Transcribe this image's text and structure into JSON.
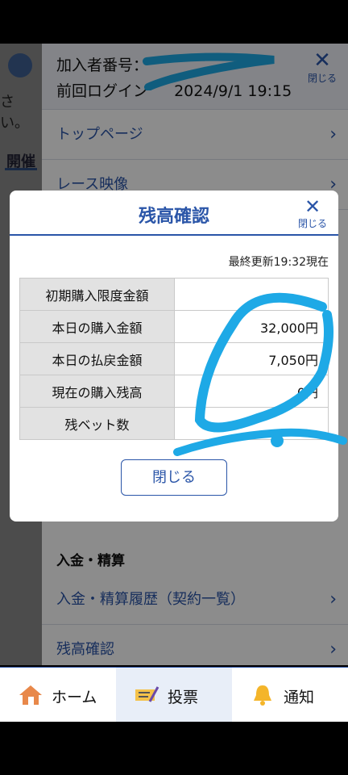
{
  "behind": {
    "partial_text_1": "さい。",
    "partial_text_2": "開催"
  },
  "drawer": {
    "member_label": "加入者番号：",
    "last_login_label": "前回ログイン",
    "last_login_value": "2024/9/1 19:15",
    "close_label": "閉じる",
    "menu": [
      {
        "label": "トップページ"
      },
      {
        "label": "レース映像"
      }
    ],
    "section_deposit": "入金・精算",
    "menu2": [
      {
        "label": "入金・精算履歴（契約一覧）"
      },
      {
        "label": "残高確認"
      }
    ]
  },
  "modal": {
    "title": "残高確認",
    "close_label": "閉じる",
    "updated": "最終更新19:32現在",
    "rows": [
      {
        "label": "初期購入限度金額",
        "value": ""
      },
      {
        "label": "本日の購入金額",
        "value": "32,000円"
      },
      {
        "label": "本日の払戻金額",
        "value": "7,050円"
      },
      {
        "label": "現在の購入残高",
        "value": "0円"
      },
      {
        "label": "残ベット数",
        "value": ""
      }
    ],
    "close_button": "閉じる"
  },
  "bottom_nav": {
    "items": [
      {
        "label": "ホーム",
        "icon": "home-icon"
      },
      {
        "label": "投票",
        "icon": "ticket-icon"
      },
      {
        "label": "通知",
        "icon": "bell-icon"
      }
    ]
  },
  "colors": {
    "accent": "#2a55a8",
    "scribble": "#1ea9e6"
  }
}
